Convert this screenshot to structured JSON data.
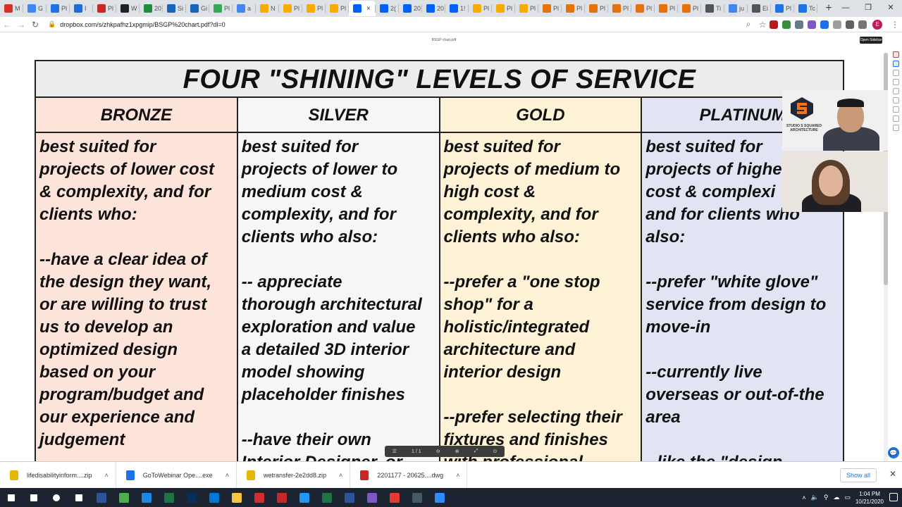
{
  "browser": {
    "tabs": [
      {
        "label": "M",
        "color": "#d93025"
      },
      {
        "label": "G",
        "color": "#4285f4"
      },
      {
        "label": "Pl",
        "color": "#1a73e8"
      },
      {
        "label": "I",
        "color": "#1e6ce0"
      },
      {
        "label": "Pl",
        "color": "#c62828"
      },
      {
        "label": "W",
        "color": "#222222"
      },
      {
        "label": "20",
        "color": "#1e8e3e"
      },
      {
        "label": "Si",
        "color": "#1565c0"
      },
      {
        "label": "Gi",
        "color": "#1565c0"
      },
      {
        "label": "Pl",
        "color": "#34a853"
      },
      {
        "label": "a",
        "color": "#4285f4"
      },
      {
        "label": "N",
        "color": "#f9ab00"
      },
      {
        "label": "Pl",
        "color": "#f9ab00"
      },
      {
        "label": "Pl",
        "color": "#f9ab00"
      },
      {
        "label": "Pl",
        "color": "#f9ab00"
      },
      {
        "label": "",
        "color": "#0061fe",
        "active": true
      },
      {
        "label": "2(",
        "color": "#0061fe"
      },
      {
        "label": "20",
        "color": "#0061fe"
      },
      {
        "label": "20",
        "color": "#0061fe"
      },
      {
        "label": "1!",
        "color": "#0061fe"
      },
      {
        "label": "Pl",
        "color": "#f9ab00"
      },
      {
        "label": "Pl",
        "color": "#f9ab00"
      },
      {
        "label": "Pl",
        "color": "#f9ab00"
      },
      {
        "label": "Pl",
        "color": "#e8710a"
      },
      {
        "label": "Pl",
        "color": "#e8710a"
      },
      {
        "label": "Pl",
        "color": "#e8710a"
      },
      {
        "label": "Pl",
        "color": "#e8710a"
      },
      {
        "label": "Pl",
        "color": "#e8710a"
      },
      {
        "label": "Pl",
        "color": "#e8710a"
      },
      {
        "label": "Pl",
        "color": "#e8710a"
      },
      {
        "label": "Ti",
        "color": "#555555"
      },
      {
        "label": "ju",
        "color": "#4285f4"
      },
      {
        "label": "Ei",
        "color": "#555555"
      },
      {
        "label": "Pl",
        "color": "#1a73e8"
      },
      {
        "label": "Tc",
        "color": "#1a73e8"
      }
    ],
    "active_tab_close": "×",
    "new_tab": "+",
    "window": {
      "minimize": "—",
      "maximize": "❐",
      "close": "✕"
    },
    "url": "dropbox.com/s/zhkpafhz1xpgmip/BSGP%20chart.pdf?dl=0",
    "profile_initial": "E",
    "extension_colors": [
      "#b71c1c",
      "#388e3c",
      "#607d8b",
      "#7e57c2",
      "#1a73e8",
      "#9e9e9e",
      "#616161",
      "#757575"
    ]
  },
  "viewer": {
    "file_name": "BSGP chart.pdf",
    "sidebar_button": "Open Sidebar",
    "page_indicator": "1 / 1"
  },
  "pdf": {
    "title": "FOUR \"SHINING\" LEVELS OF SERVICE",
    "levels": [
      {
        "name": "BRONZE",
        "color": "#fde4da",
        "text": "best suited for\nprojects of lower cost\n& complexity, and for\nclients who:\n\n--have a clear idea of\nthe design they want,\nor are willing to trust\nus to develop an\noptimized design\nbased on your\nprogram/budget and\nour experience and\njudgement"
      },
      {
        "name": "SILVER",
        "color": "#f6f6f6",
        "text": "best suited for\nprojects of lower to\nmedium cost &\ncomplexity, and for\nclients who also:\n\n-- appreciate\nthorough architectural\nexploration and value\na detailed 3D interior\nmodel showing\nplaceholder finishes\n\n--have their own\nInterior Designer, or"
      },
      {
        "name": "GOLD",
        "color": "#fdf1d6",
        "text": "best suited for\nprojects of medium to\nhigh cost &\ncomplexity, and for\nclients who also:\n\n--prefer a \"one stop\nshop\" for a\nholistic/integrated\narchitecture and\ninterior design\n\n--prefer selecting their\nfixtures and finishes\nwith professional"
      },
      {
        "name": "PLATINUM",
        "color": "#e2e4f4",
        "text": "best suited for\nprojects of highe\ncost & complexi\nand for clients who\nalso:\n\n--prefer \"white glove\"\nservice from design to\nmove-in\n\n--currently live\noverseas or out-of-the\narea\n\n--like the \"design"
      }
    ]
  },
  "webinar": {
    "logo_text": "STUDIO S SQUARED ARCHITECTURE"
  },
  "downloads": {
    "items": [
      {
        "name": "lifedisabilityinform....zip",
        "color": "#e6b800"
      },
      {
        "name": "GoToWebinar Ope....exe",
        "color": "#1a73e8"
      },
      {
        "name": "wetransfer-2e2dd8.zip",
        "color": "#e6b800"
      },
      {
        "name": "2201177 - 20625....dwg",
        "color": "#c62828"
      }
    ],
    "show_all": "Show all",
    "close": "✕"
  },
  "taskbar": {
    "apps": [
      {
        "name": "start",
        "color": "#ffffff"
      },
      {
        "name": "search",
        "color": "#ffffff"
      },
      {
        "name": "cortana",
        "color": "#ffffff"
      },
      {
        "name": "task-view",
        "color": "#ffffff"
      },
      {
        "name": "word",
        "color": "#2b579a"
      },
      {
        "name": "chrome",
        "color": "#4caf50"
      },
      {
        "name": "app-blue",
        "color": "#1e88e5"
      },
      {
        "name": "excel",
        "color": "#217346"
      },
      {
        "name": "photoshop",
        "color": "#0a2e5c"
      },
      {
        "name": "edge",
        "color": "#0078d7"
      },
      {
        "name": "file-explorer",
        "color": "#f5c542"
      },
      {
        "name": "acrobat",
        "color": "#d32f2f"
      },
      {
        "name": "autocad",
        "color": "#c62828"
      },
      {
        "name": "app-ring",
        "color": "#2196f3"
      },
      {
        "name": "excel-2",
        "color": "#217346"
      },
      {
        "name": "word-2",
        "color": "#2b579a"
      },
      {
        "name": "app-purple",
        "color": "#7e57c2"
      },
      {
        "name": "app-red",
        "color": "#e53935"
      },
      {
        "name": "app-dark",
        "color": "#455a64"
      },
      {
        "name": "zoom",
        "color": "#2d8cff"
      }
    ],
    "time": "1:04 PM",
    "date": "10/21/2020"
  }
}
